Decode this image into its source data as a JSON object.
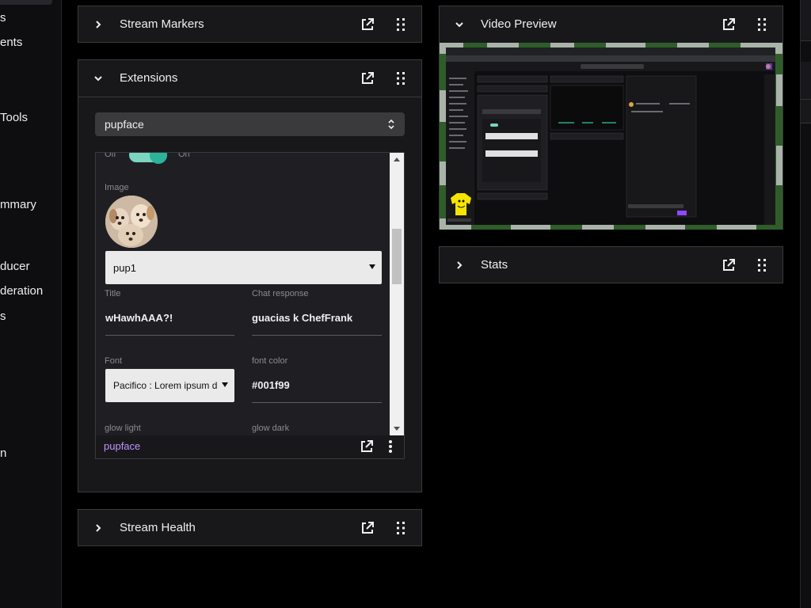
{
  "sidebar": {
    "items": [
      {
        "label": "s"
      },
      {
        "label": "ents"
      },
      {
        "label": " Tools"
      },
      {
        "label": "mmary"
      },
      {
        "label": "ducer"
      },
      {
        "label": "deration"
      },
      {
        "label": "s"
      },
      {
        "label": "n"
      }
    ]
  },
  "panels": {
    "stream_markers": {
      "title": "Stream Markers"
    },
    "extensions": {
      "title": "Extensions"
    },
    "stream_health": {
      "title": "Stream Health"
    },
    "video_preview": {
      "title": "Video Preview"
    },
    "stats": {
      "title": "Stats"
    }
  },
  "extension_select": {
    "value": "pupface"
  },
  "extension_config": {
    "toggle": {
      "off_label": "Off",
      "on_label": "On",
      "checked": true
    },
    "image_label": "Image",
    "image_select": "pup1",
    "title_label": "Title",
    "title_value": "wHawhAAA?!",
    "chat_response_label": "Chat response",
    "chat_response_value": "guacias k ChefFrank",
    "font_label": "Font",
    "font_value": "Pacifico : Lorem ipsum d",
    "font_color_label": "font color",
    "font_color_value": "#001f99",
    "glow_light_label": "glow light",
    "glow_dark_label": "glow dark"
  },
  "extension_footer": {
    "name": "pupface"
  },
  "colors": {
    "accent": "#bf94ff",
    "panel_bg": "#18181b",
    "border": "#3a3a3d",
    "toggle_track": "#7ad6c1",
    "toggle_knob": "#2bb39b"
  },
  "icons": {
    "expand": "chevron-right-icon",
    "collapse": "chevron-down-icon",
    "popout": "popout-icon",
    "drag": "drag-handle-icon",
    "more": "more-vertical-icon"
  }
}
